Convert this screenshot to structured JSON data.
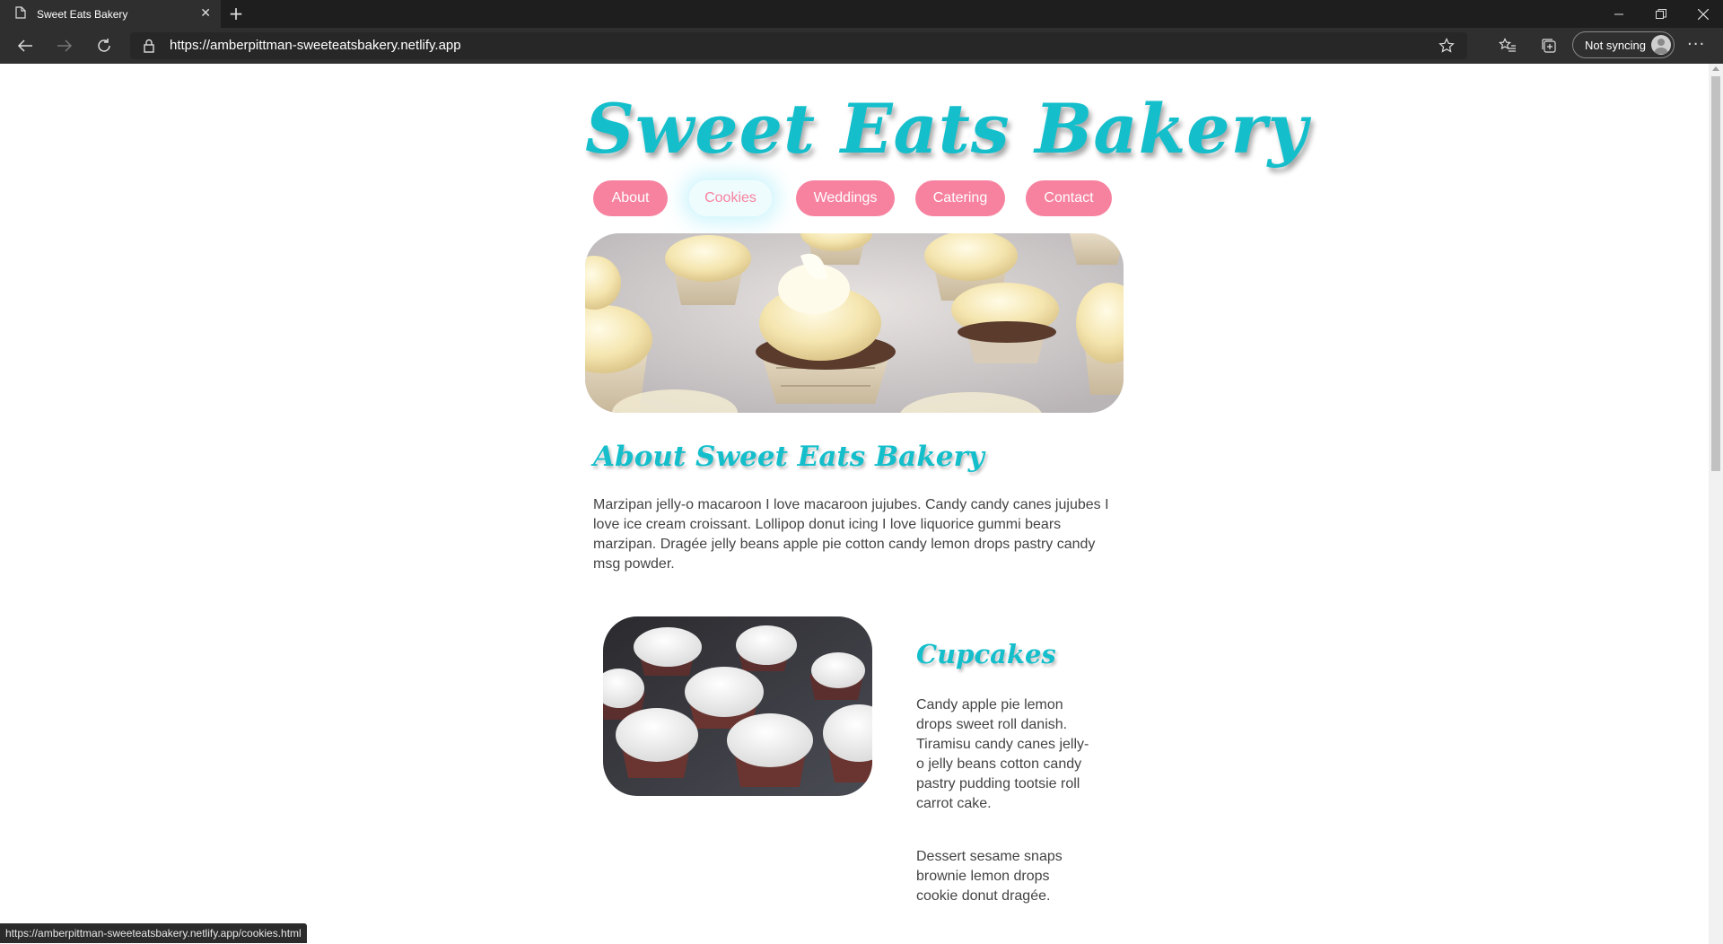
{
  "browser": {
    "tab_title": "Sweet Eats Bakery",
    "url": "https://amberpittman-sweeteatsbakery.netlify.app",
    "sync_label": "Not syncing",
    "status_url": "https://amberpittman-sweeteatsbakery.netlify.app/cookies.html"
  },
  "site": {
    "title": "Sweet Eats Bakery",
    "nav": [
      "About",
      "Cookies",
      "Weddings",
      "Catering",
      "Contact"
    ],
    "active_nav": "Cookies",
    "about_heading": "About Sweet Eats Bakery",
    "about_text": "Marzipan jelly-o macaroon I love macaroon jujubes. Candy candy canes jujubes I love ice cream croissant. Lollipop donut icing I love liquorice gummi bears marzipan. Dragée jelly beans apple pie cotton candy lemon drops pastry candy msg powder.",
    "cupcakes_heading": "Cupcakes",
    "cupcakes_text_1": "Candy apple pie lemon drops sweet roll danish. Tiramisu candy canes jelly-o jelly beans cotton candy pastry pudding tootsie roll carrot cake.",
    "cupcakes_text_2": "Dessert sesame snaps brownie lemon drops cookie donut dragée."
  },
  "colors": {
    "accent_teal": "#14bfcb",
    "nav_pink": "#f7829f",
    "body_text": "#444444"
  },
  "icons": [
    "page-icon",
    "close-icon",
    "plus-icon",
    "minimize-icon",
    "restore-icon",
    "close-window-icon",
    "back-arrow-icon",
    "forward-arrow-icon",
    "refresh-icon",
    "lock-icon",
    "star-icon",
    "favorites-icon",
    "collections-icon",
    "avatar-icon",
    "more-icon"
  ]
}
